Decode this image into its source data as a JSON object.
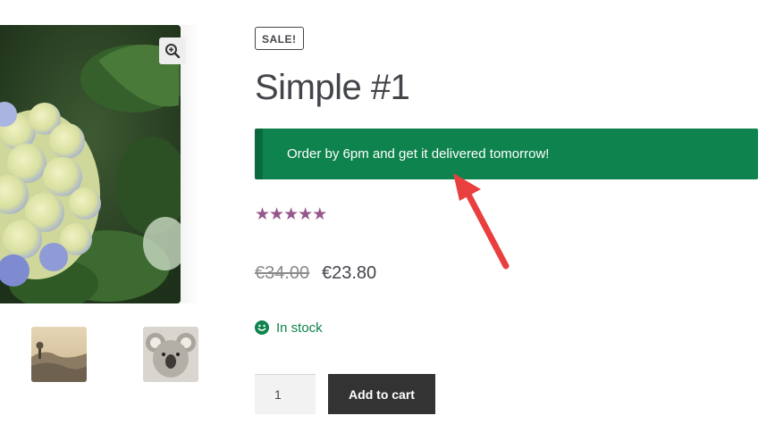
{
  "gallery": {
    "main_image_icon": "hydrangea-photo",
    "zoom_icon": "zoom-in-icon",
    "thumbnails": [
      {
        "icon": "landscape-photo"
      },
      {
        "icon": "koala-photo"
      }
    ]
  },
  "product": {
    "sale_badge": "SALE!",
    "title": "Simple #1",
    "delivery_notice": "Order by 6pm and get it delivered tomorrow!",
    "rating": {
      "value": 5,
      "max": 5,
      "color": "#96588a"
    },
    "price_old": "€34.00",
    "price_new": "€23.80",
    "stock_status": "In stock",
    "quantity": "1",
    "add_to_cart_label": "Add to cart"
  },
  "colors": {
    "notice_background": "#0f834d",
    "stock_green": "#0f834d",
    "button_dark": "#333333",
    "arrow_red": "#e8403f"
  }
}
